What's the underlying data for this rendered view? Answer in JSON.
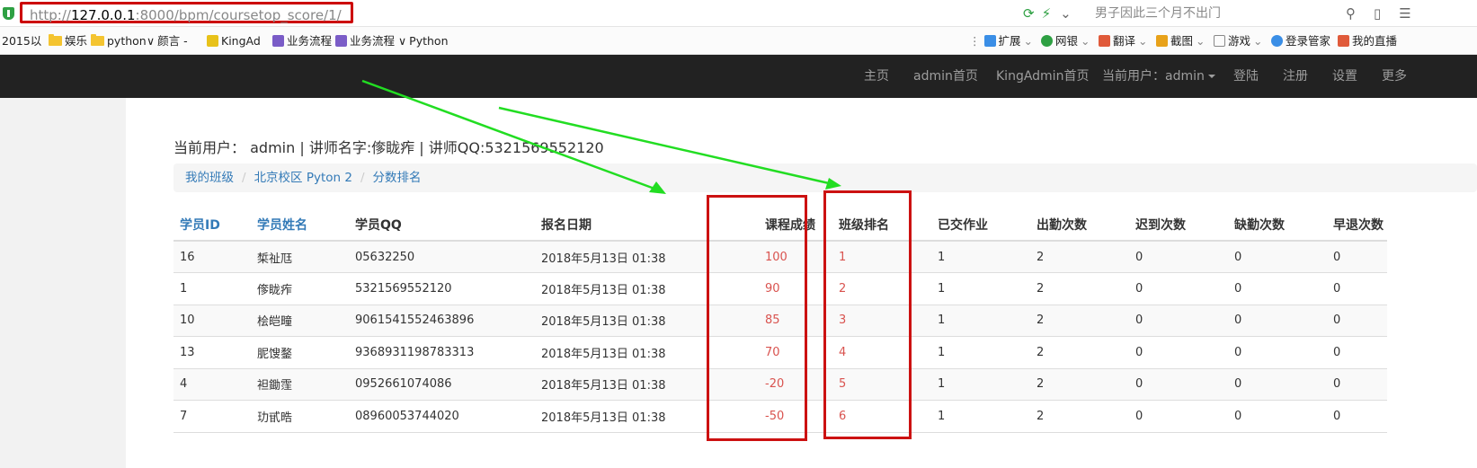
{
  "browser": {
    "url_scheme": "http://",
    "url_host": "127.0.0.1",
    "url_rest": ":8000/bpm/coursetop_score/1/",
    "search_placeholder": "男子因此三个月不出门"
  },
  "bookmarks": [
    {
      "label": "2015以",
      "icon": "none"
    },
    {
      "label": "娱乐",
      "icon": "folder-icon"
    },
    {
      "label": "python",
      "icon": "folder-icon"
    },
    {
      "label": "颜言 -",
      "icon": "link-icon"
    },
    {
      "label": "KingAd",
      "icon": "kingad-icon"
    },
    {
      "label": "业务流程",
      "icon": "page-icon"
    },
    {
      "label": "业务流程",
      "icon": "page-icon"
    },
    {
      "label": "Python",
      "icon": "link-icon"
    }
  ],
  "toolbar_right": [
    {
      "label": "扩展",
      "has_caret": true
    },
    {
      "label": "网银",
      "has_caret": true
    },
    {
      "label": "翻译",
      "has_caret": true
    },
    {
      "label": "截图",
      "has_caret": true
    },
    {
      "label": "游戏",
      "has_caret": true
    },
    {
      "label": "登录管家",
      "has_caret": false
    },
    {
      "label": "我的直播",
      "has_caret": false
    }
  ],
  "navbar": {
    "items": [
      {
        "label": "主页"
      },
      {
        "label": "admin首页"
      },
      {
        "label": "KingAdmin首页"
      },
      {
        "label": "当前用户：admin"
      },
      {
        "label": "登陆"
      },
      {
        "label": "注册"
      },
      {
        "label": "设置"
      },
      {
        "label": "更多"
      }
    ]
  },
  "user_info": {
    "prefix": "当前用户：",
    "username": "admin",
    "rest": " | 讲师名字:偧眬痄 | 讲师QQ:5321569552120"
  },
  "breadcrumb": [
    {
      "label": "我的班级"
    },
    {
      "label": "北京校区 Pyton 2"
    },
    {
      "label": "分数排名"
    }
  ],
  "table": {
    "headers": [
      "学员ID",
      "学员姓名",
      "学员QQ",
      "报名日期",
      "课程成绩",
      "班级排名",
      "已交作业",
      "出勤次数",
      "迟到次数",
      "缺勤次数",
      "早退次数"
    ],
    "rows": [
      [
        "16",
        "椞祉尫",
        "05632250",
        "2018年5月13日 01:38",
        "100",
        "1",
        "1",
        "2",
        "0",
        "0",
        "0"
      ],
      [
        "1",
        "偧眬痄",
        "5321569552120",
        "2018年5月13日 01:38",
        "90",
        "2",
        "1",
        "2",
        "0",
        "0",
        "0"
      ],
      [
        "10",
        "桧皑疃",
        "9061541552463896",
        "2018年5月13日 01:38",
        "85",
        "3",
        "1",
        "2",
        "0",
        "0",
        "0"
      ],
      [
        "13",
        "胒馊鍪",
        "9368931198783313",
        "2018年5月13日 01:38",
        "70",
        "4",
        "1",
        "2",
        "0",
        "0",
        "0"
      ],
      [
        "4",
        "袒鋤霔",
        "0952661074086",
        "2018年5月13日 01:38",
        "-20",
        "5",
        "1",
        "2",
        "0",
        "0",
        "0"
      ],
      [
        "7",
        "玏甙晧",
        "08960053744020",
        "2018年5月13日 01:38",
        "-50",
        "6",
        "1",
        "2",
        "0",
        "0",
        "0"
      ]
    ]
  },
  "colors": {
    "navbar_bg": "#222222",
    "link": "#337ab7",
    "score_red": "#d9534f",
    "highlight_box": "#cc1111",
    "arrow_green": "#22dd22"
  }
}
